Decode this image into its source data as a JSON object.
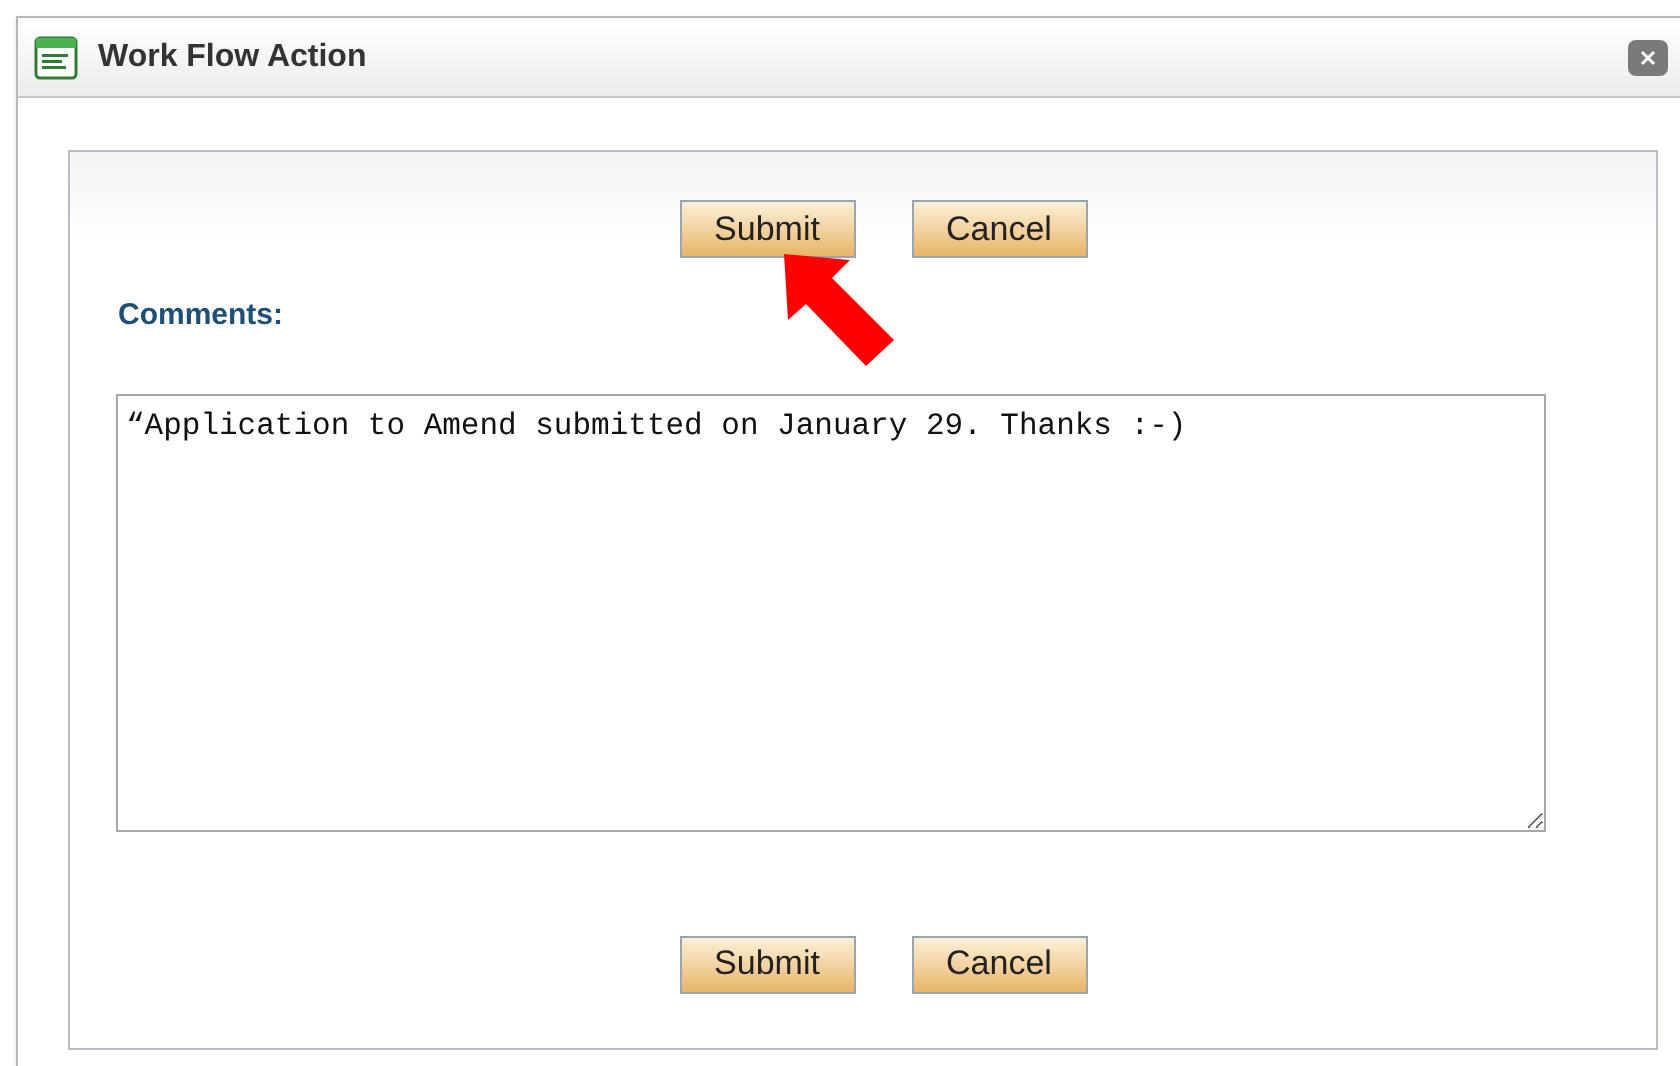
{
  "window": {
    "title": "Work Flow Action"
  },
  "top_buttons": [
    "Submit",
    "Cancel"
  ],
  "comments": {
    "label": "Comments:",
    "value": "“Application to Amend submitted on January 29. Thanks :-)"
  },
  "bottom_buttons": [
    "Submit",
    "Cancel"
  ]
}
